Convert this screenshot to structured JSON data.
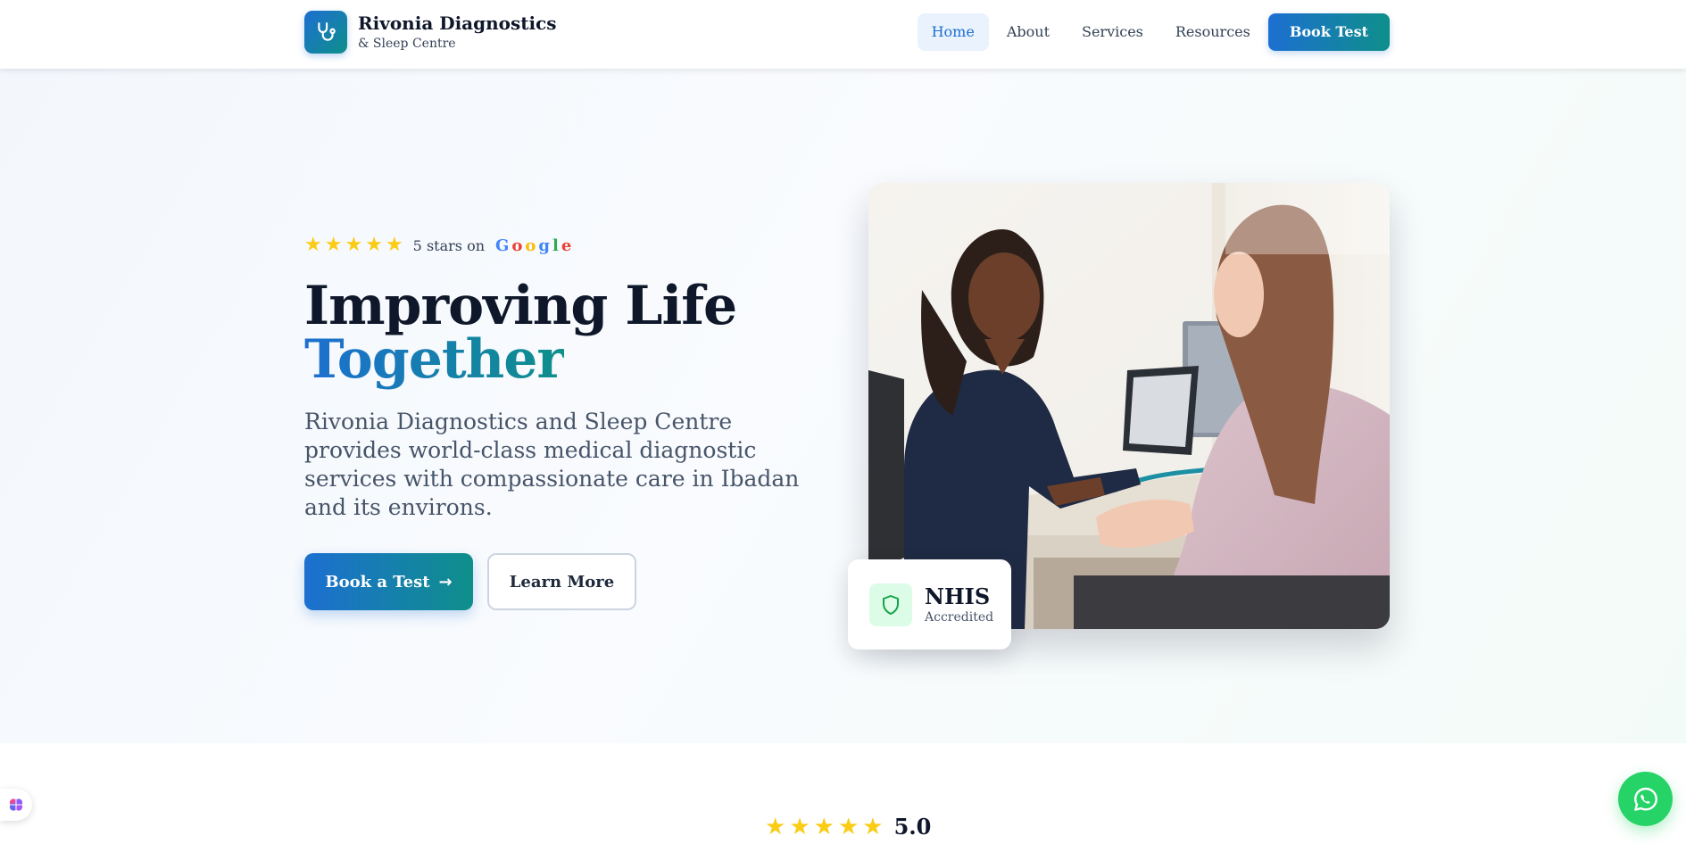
{
  "header": {
    "brand_name": "Rivonia Diagnostics",
    "brand_sub": "& Sleep Centre",
    "logo_icon": "stethoscope-icon",
    "nav": [
      {
        "label": "Home",
        "active": true
      },
      {
        "label": "About"
      },
      {
        "label": "Services"
      },
      {
        "label": "Resources"
      }
    ],
    "cta_label": "Book Test"
  },
  "hero": {
    "rating": {
      "stars": 5,
      "text": "5 stars on",
      "google_letters": [
        "G",
        "o",
        "o",
        "g",
        "l",
        "e"
      ]
    },
    "headline_line1": "Improving Life",
    "headline_line2": "Together",
    "description": "Rivonia Diagnostics and Sleep Centre provides world-class medical diagnostic services with compassionate care in Ibadan and its environs.",
    "primary_button": "Book a Test",
    "primary_button_icon": "arrow-right-icon",
    "secondary_button": "Learn More",
    "image_alt": "doctor-consulting-patient-photo",
    "badge": {
      "icon": "shield-icon",
      "title": "NHIS",
      "subtitle": "Accredited"
    }
  },
  "reviews": {
    "stars": 5,
    "score": "5.0"
  },
  "floating": {
    "whatsapp_icon": "whatsapp-icon",
    "widget_icon": "brain-icon"
  },
  "colors": {
    "primary_blue": "#1d6fd1",
    "primary_teal": "#0e8f8a",
    "star": "#facc15",
    "whatsapp": "#25d366",
    "text_dark": "#0f172a"
  }
}
